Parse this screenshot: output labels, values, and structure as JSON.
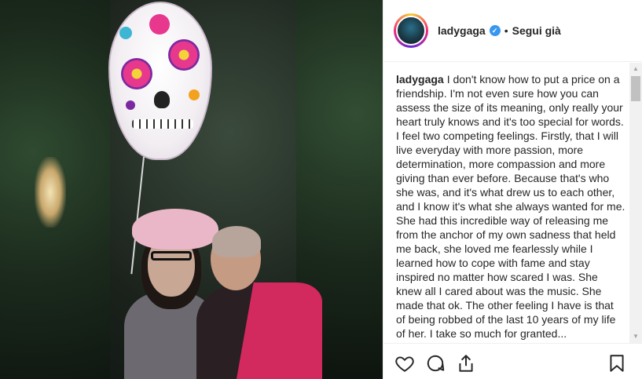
{
  "post": {
    "username": "ladygaga",
    "verified_badge": "✓",
    "separator": "•",
    "follow_label": "Segui già",
    "caption_user": "ladygaga",
    "caption_text": "I don't know how to put a price on a friendship. I'm not even sure how you can assess the size of its meaning, only really your heart truly knows and it's too special for words. I feel two competing feelings. Firstly, that I will live everyday with more passion, more determination, more compassion and more giving than ever before. Because that's who she was, and it's what drew us to each other, and I know it's what she always wanted for me. She had this incredible way of releasing me from the anchor of my own sadness that held me back, she loved me fearlessly while I learned how to cope with fame and stay inspired no matter how scared I was. She knew all I cared about was the music. She made that ok. The other feeling I have is that of being robbed of the last 10 years of my life of her. I take so much for granted..."
  },
  "scrollbar": {
    "up": "▲",
    "down": "▼"
  },
  "icons": {
    "like": "heart-icon",
    "comment": "comment-icon",
    "share": "share-icon",
    "save": "bookmark-icon"
  },
  "colors": {
    "verified": "#3897f0",
    "text": "#262626",
    "border": "#efefef"
  }
}
